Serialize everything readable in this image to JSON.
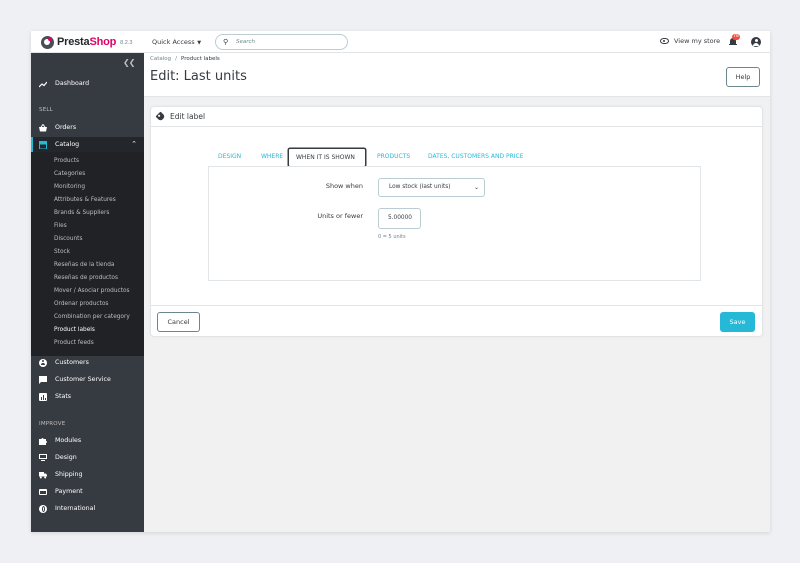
{
  "header": {
    "brand_pre": "Presta",
    "brand_post": "Shop",
    "version": "8.2.3",
    "quick_access": "Quick Access",
    "search_placeholder": "Search",
    "view_store": "View my store",
    "notification_count": "78"
  },
  "sidebar": {
    "dashboard": "Dashboard",
    "sell_section": "SELL",
    "orders": "Orders",
    "catalog": "Catalog",
    "catalog_sub": [
      "Products",
      "Categories",
      "Monitoring",
      "Attributes & Features",
      "Brands & Suppliers",
      "Files",
      "Discounts",
      "Stock",
      "Reseñas de la tienda",
      "Reseñas de productos",
      "Mover / Asociar productos",
      "Ordenar productos",
      "Combination per category",
      "Product labels",
      "Product feeds"
    ],
    "customers": "Customers",
    "customer_service": "Customer Service",
    "stats": "Stats",
    "improve_section": "IMPROVE",
    "modules": "Modules",
    "design": "Design",
    "shipping": "Shipping",
    "payment": "Payment",
    "international": "International"
  },
  "page": {
    "breadcrumb_parent": "Catalog",
    "breadcrumb_current": "Product labels",
    "title": "Edit: Last units",
    "help_label": "Help"
  },
  "card": {
    "title": "Edit label",
    "tabs": [
      "DESIGN",
      "WHERE",
      "WHEN IT IS SHOWN",
      "PRODUCTS",
      "DATES, CUSTOMERS AND PRICE"
    ],
    "active_tab": "WHEN IT IS SHOWN",
    "show_when_label": "Show when",
    "show_when_value": "Low stock (last units)",
    "units_label": "Units or fewer",
    "units_value": "5.00000",
    "units_hint": "0 = 5 units",
    "cancel_label": "Cancel",
    "save_label": "Save"
  },
  "colors": {
    "accent": "#25b9d7",
    "sidebar": "#363a41",
    "brand_pink": "#df0067",
    "badge": "#f54c3e"
  }
}
